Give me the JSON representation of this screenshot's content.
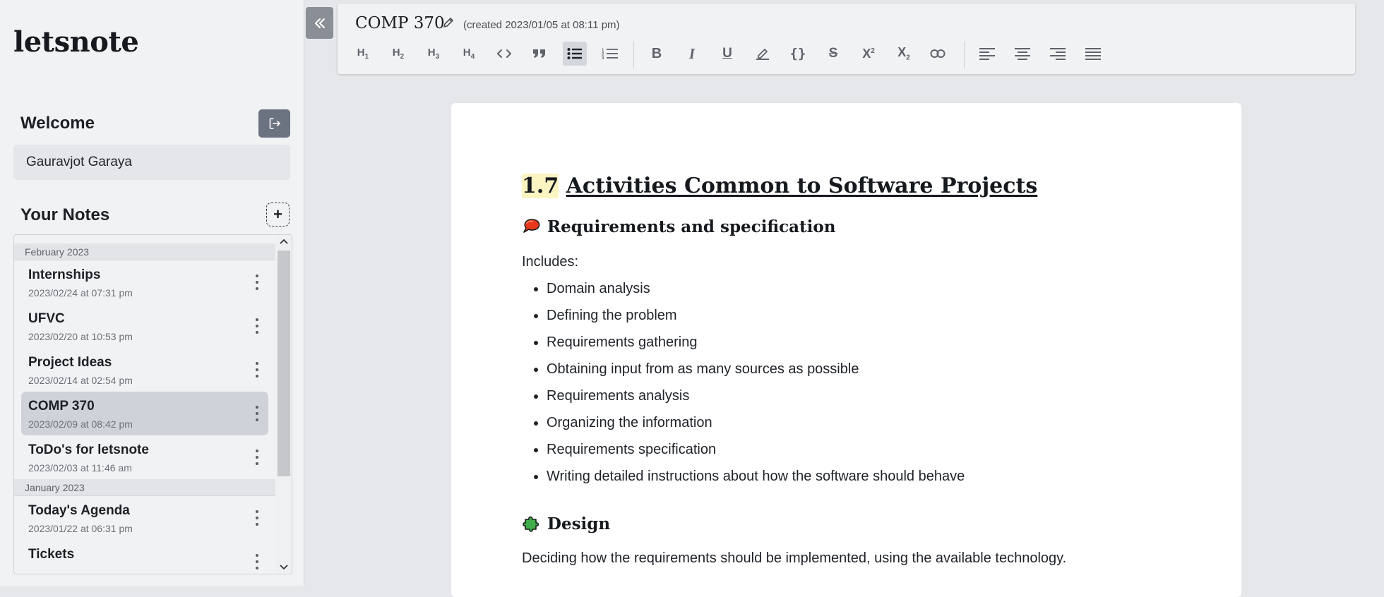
{
  "app": {
    "name": "letsnote"
  },
  "sidebar": {
    "welcome_label": "Welcome",
    "user_name": "Gauravjot Garaya",
    "notes_heading": "Your Notes",
    "add_label": "+",
    "groups": [
      {
        "label": "February 2023",
        "notes": [
          {
            "title": "Internships",
            "date": "2023/02/24 at 07:31 pm"
          },
          {
            "title": "UFVC",
            "date": "2023/02/20 at 10:53 pm"
          },
          {
            "title": "Project Ideas",
            "date": "2023/02/14 at 02:54 pm"
          },
          {
            "title": "COMP 370",
            "date": "2023/02/09 at 08:42 pm",
            "selected": true
          },
          {
            "title": "ToDo's for letsnote",
            "date": "2023/02/03 at 11:46 am"
          }
        ]
      },
      {
        "label": "January 2023",
        "notes": [
          {
            "title": "Today's Agenda",
            "date": "2023/01/22 at 06:31 pm"
          },
          {
            "title": "Tickets",
            "date": ""
          }
        ]
      }
    ]
  },
  "editor": {
    "title": "COMP 370",
    "created": "(created 2023/01/05 at 08:11 pm)",
    "toolbar": {
      "tools": [
        "H1",
        "H2",
        "H3",
        "H4",
        "code-icon",
        "quote-icon",
        "bullet-list-icon",
        "ordered-list-icon",
        "bold-icon",
        "italic-icon",
        "underline-icon",
        "highlight-icon",
        "code-block-icon",
        "strikethrough-icon",
        "superscript-icon",
        "subscript-icon",
        "link-icon",
        "align-left-icon",
        "align-center-icon",
        "align-right-icon",
        "align-justify-icon"
      ],
      "active_tool": "bullet-list-icon"
    },
    "content": {
      "heading_number": "1.7",
      "heading_text": "Activities Common to Software Projects",
      "section1_title": "Requirements and specification",
      "section1_emoji": "speech-balloon-icon",
      "includes_label": "Includes:",
      "bullets": [
        "Domain analysis",
        "Defining the problem",
        "Requirements gathering",
        "Obtaining input from as many sources as possible",
        "Requirements analysis",
        "Organizing the information",
        "Requirements specification",
        "Writing detailed instructions about how the software should behave"
      ],
      "section2_title": "Design",
      "section2_emoji": "puzzle-piece-icon",
      "section2_text": "Deciding how the requirements should be implemented, using the available technology."
    }
  },
  "colors": {
    "highlight": "#fcf4c1",
    "button_dark": "#6b7280",
    "selected_note": "#cfd2d8"
  }
}
